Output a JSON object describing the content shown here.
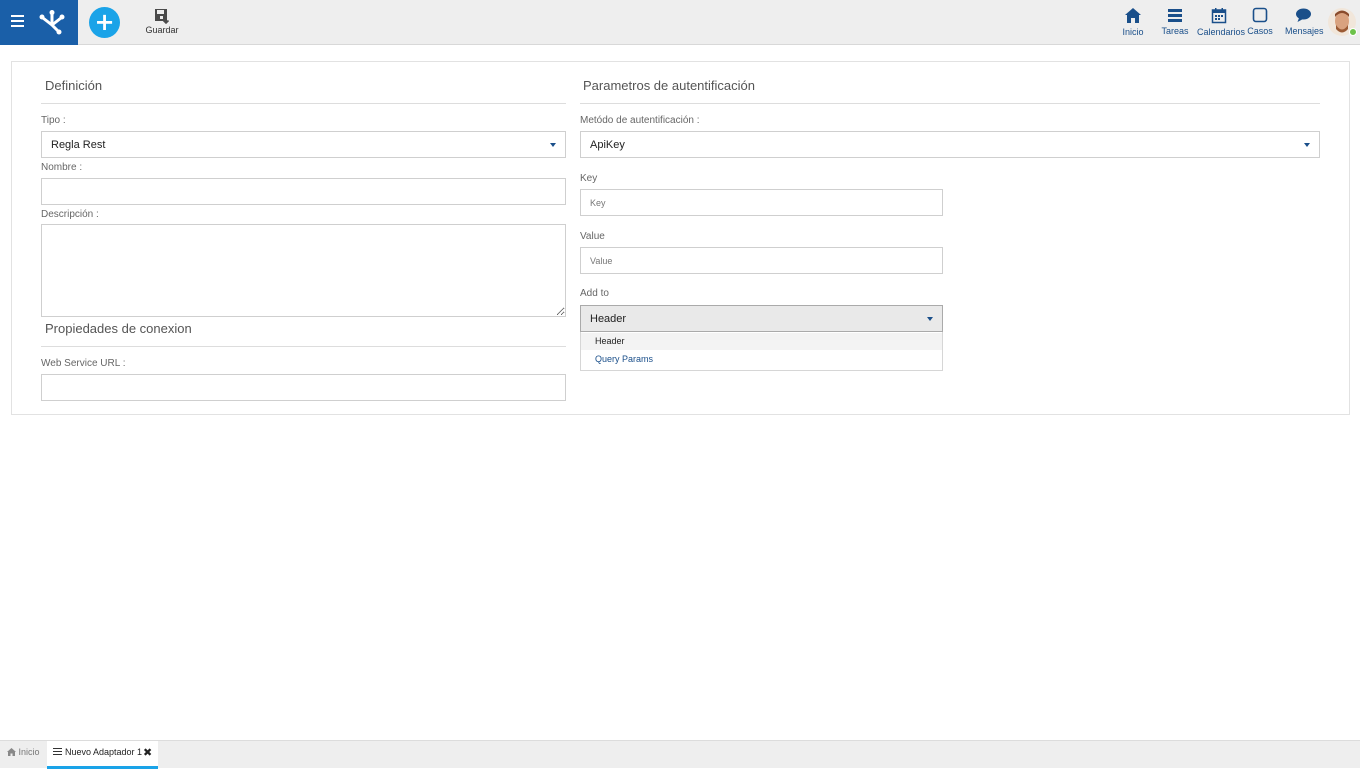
{
  "toolbar": {
    "save_label": "Guardar",
    "add_symbol": "+"
  },
  "nav": {
    "inicio": "Inicio",
    "tareas": "Tareas",
    "calendarios": "Calendarios",
    "casos": "Casos",
    "mensajes": "Mensajes"
  },
  "definicion": {
    "title": "Definición",
    "tipo_label": "Tipo :",
    "tipo_value": "Regla Rest",
    "nombre_label": "Nombre :",
    "nombre_value": "",
    "descripcion_label": "Descripción :",
    "descripcion_value": ""
  },
  "conexion": {
    "title": "Propiedades de conexion",
    "url_label": "Web Service URL :",
    "url_value": ""
  },
  "auth": {
    "title": "Parametros de autentificación",
    "metodo_label": "Metódo de autentificación :",
    "metodo_value": "ApiKey",
    "key_label": "Key",
    "key_placeholder": "Key",
    "value_label": "Value",
    "value_placeholder": "Value",
    "addto_label": "Add to",
    "addto_value": "Header",
    "addto_options": [
      "Header",
      "Query Params"
    ]
  },
  "bottom_tabs": {
    "home": "Inicio",
    "active": "Nuevo Adaptador 1",
    "close_symbol": "✖"
  },
  "colors": {
    "brand_blue": "#1a5fa8",
    "accent_cyan": "#1aa3e8",
    "nav_text": "#1a4f8a",
    "status_online": "#6cc24a"
  }
}
